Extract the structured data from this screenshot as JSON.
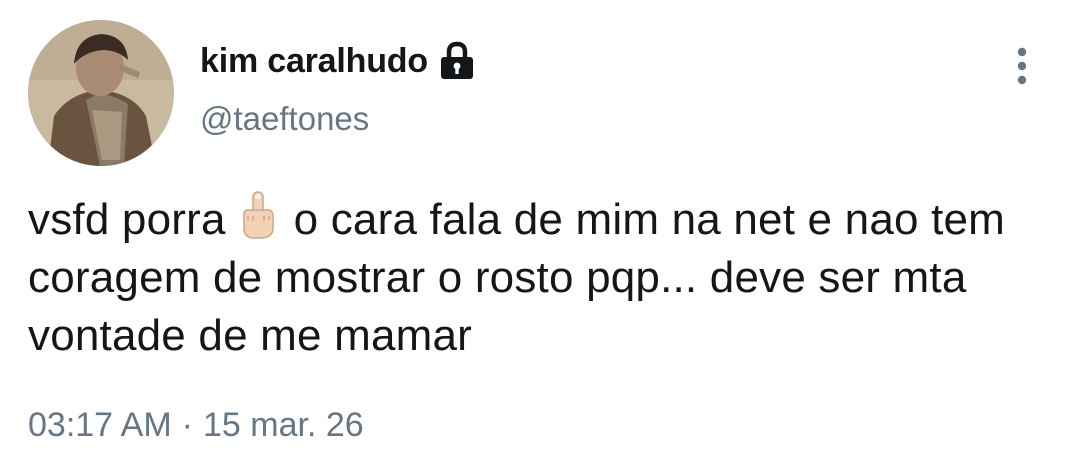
{
  "user": {
    "display_name": "kim caralhudo",
    "handle": "@taeftones",
    "avatar_icon": "user-avatar",
    "protected_icon": "lock-icon"
  },
  "menu": {
    "icon": "more-vertical-icon"
  },
  "tweet": {
    "text_before_emoji": "vsfd porra",
    "emoji": "middle-finger-emoji",
    "text_after_emoji": "o cara fala de mim na net e nao tem coragem de mostrar o rosto pqp... deve ser mta vontade de me mamar",
    "time": "03:17 AM",
    "separator": "·",
    "date": "15 mar. 26"
  },
  "colors": {
    "text": "#14171a",
    "secondary": "#657786",
    "background": "#ffffff"
  }
}
